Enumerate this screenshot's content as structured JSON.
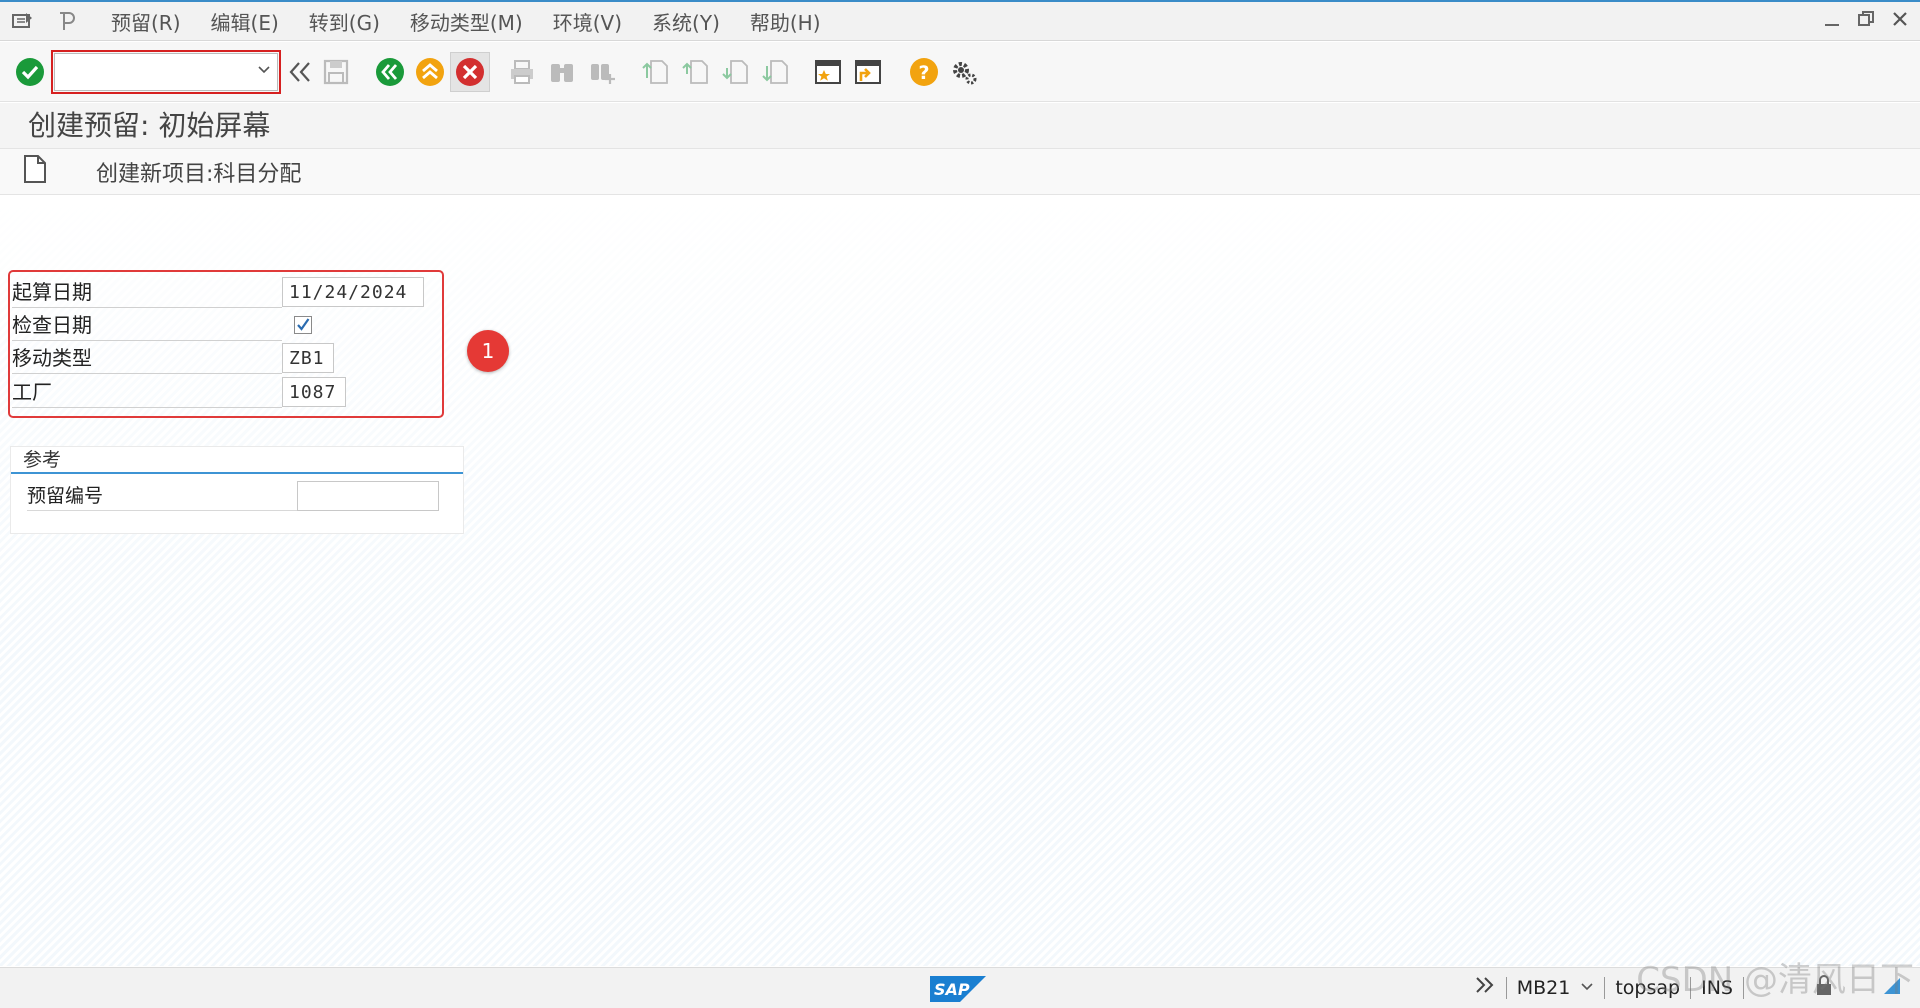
{
  "menu": {
    "items": [
      {
        "label": "预留(R)"
      },
      {
        "label": "编辑(E)"
      },
      {
        "label": "转到(G)"
      },
      {
        "label": "移动类型(M)"
      },
      {
        "label": "环境(V)"
      },
      {
        "label": "系统(Y)"
      },
      {
        "label": "帮助(H)"
      }
    ]
  },
  "toolbar": {
    "command_value": ""
  },
  "screen": {
    "title": "创建预留: 初始屏幕",
    "app_toolbar_label": "创建新项目:科目分配"
  },
  "form": {
    "base_date_label": "起算日期",
    "base_date_value": "11/24/2024",
    "check_date_label": "检查日期",
    "check_date_checked": true,
    "movement_type_label": "移动类型",
    "movement_type_value": "ZB1",
    "plant_label": "工厂",
    "plant_value": "1087"
  },
  "annotation": {
    "badge_number": "1"
  },
  "reference": {
    "group_title": "参考",
    "reservation_number_label": "预留编号",
    "reservation_number_value": ""
  },
  "statusbar": {
    "transaction": "MB21",
    "user": "topsap",
    "mode": "INS",
    "watermark": "CSDN @清风日下"
  },
  "colors": {
    "accent": "#3d94d4",
    "highlight": "#e03a3a",
    "badge": "#e53935",
    "ok_green": "#1a9a3a",
    "cancel_red": "#d32f2f",
    "exit_orange": "#f2a30f"
  }
}
